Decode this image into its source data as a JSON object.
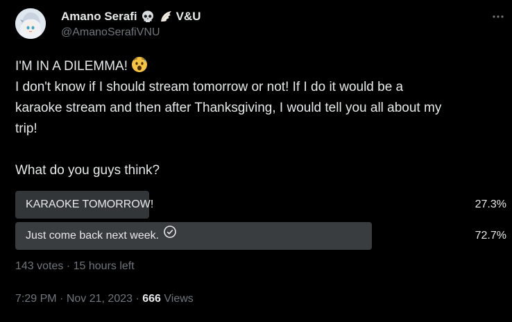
{
  "author": {
    "display_name": "Amano Serafi",
    "name_suffix": "V&U",
    "handle": "@AmanoSerafiVNU",
    "emoji_icons": [
      "skull-icon",
      "wing-icon"
    ]
  },
  "tweet": {
    "lines": [
      "I'M IN A DILEMMA!",
      "I don't know if I should stream tomorrow or not! If I do it would be a",
      "karaoke stream and then after Thanksgiving, I would tell you all about my",
      "trip!",
      "",
      "What do you guys think?"
    ],
    "headline_emoji": "anxious-face-icon"
  },
  "poll": {
    "options": [
      {
        "label": "KARAOKE TOMORROW!",
        "percent_text": "27.3%",
        "share": 0.273,
        "winner": false
      },
      {
        "label": "Just come back next week.",
        "percent_text": "72.7%",
        "share": 0.727,
        "winner": true
      }
    ],
    "votes_text": "143 votes",
    "separator": "·",
    "time_left_text": "15 hours left"
  },
  "meta": {
    "time": "7:29 PM",
    "date": "Nov 21, 2023",
    "separator": "·",
    "views_count": "666",
    "views_label": "Views"
  },
  "colors": {
    "background": "#000000",
    "text_primary": "#e7e9ea",
    "text_secondary": "#71767b",
    "poll_bar_loser": "#333639",
    "poll_bar_winner": "#3a3d40"
  }
}
